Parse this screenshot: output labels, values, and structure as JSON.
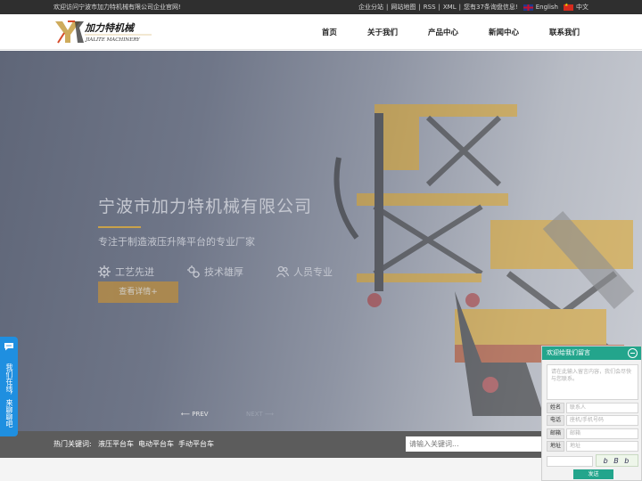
{
  "topbar": {
    "welcome": "欢迎访问宁波市加力特机械有限公司企业官网!",
    "links": [
      "企业分站",
      "网站地图",
      "RSS",
      "XML"
    ],
    "inquiry": "您有37条询盘信息!",
    "lang_en": "English",
    "lang_cn": "中文"
  },
  "logo": {
    "cn": "加力特机械",
    "en": "JIALITE MACHINERY"
  },
  "nav": {
    "items": [
      "首页",
      "关于我们",
      "产品中心",
      "新闻中心",
      "联系我们"
    ]
  },
  "hero": {
    "title": "宁波市加力特机械有限公司",
    "subtitle": "专注于制造液压升降平台的专业厂家",
    "features": [
      "工艺先进",
      "技术雄厚",
      "人员专业"
    ],
    "detail_button": "查看详情+",
    "prev": "PREV",
    "next": "NEXT",
    "accent_color": "#c9a24a"
  },
  "keywords": {
    "label": "热门关键词:",
    "items": [
      "液压平台车",
      "电动平台车",
      "手动平台车"
    ],
    "search_placeholder": "请输入关键词..."
  },
  "side_chat": {
    "label": "我们在线，来聊聊吧"
  },
  "message_panel": {
    "title": "欢迎给我们留言",
    "content_placeholder": "请在此输入留言内容，我们会尽快与您联系。",
    "fields": [
      {
        "label": "姓名",
        "placeholder": "联系人"
      },
      {
        "label": "电话",
        "placeholder": "座机/手机号码"
      },
      {
        "label": "邮箱",
        "placeholder": "邮箱"
      },
      {
        "label": "地址",
        "placeholder": "地址"
      }
    ],
    "captcha": "b B b",
    "send": "发送"
  }
}
